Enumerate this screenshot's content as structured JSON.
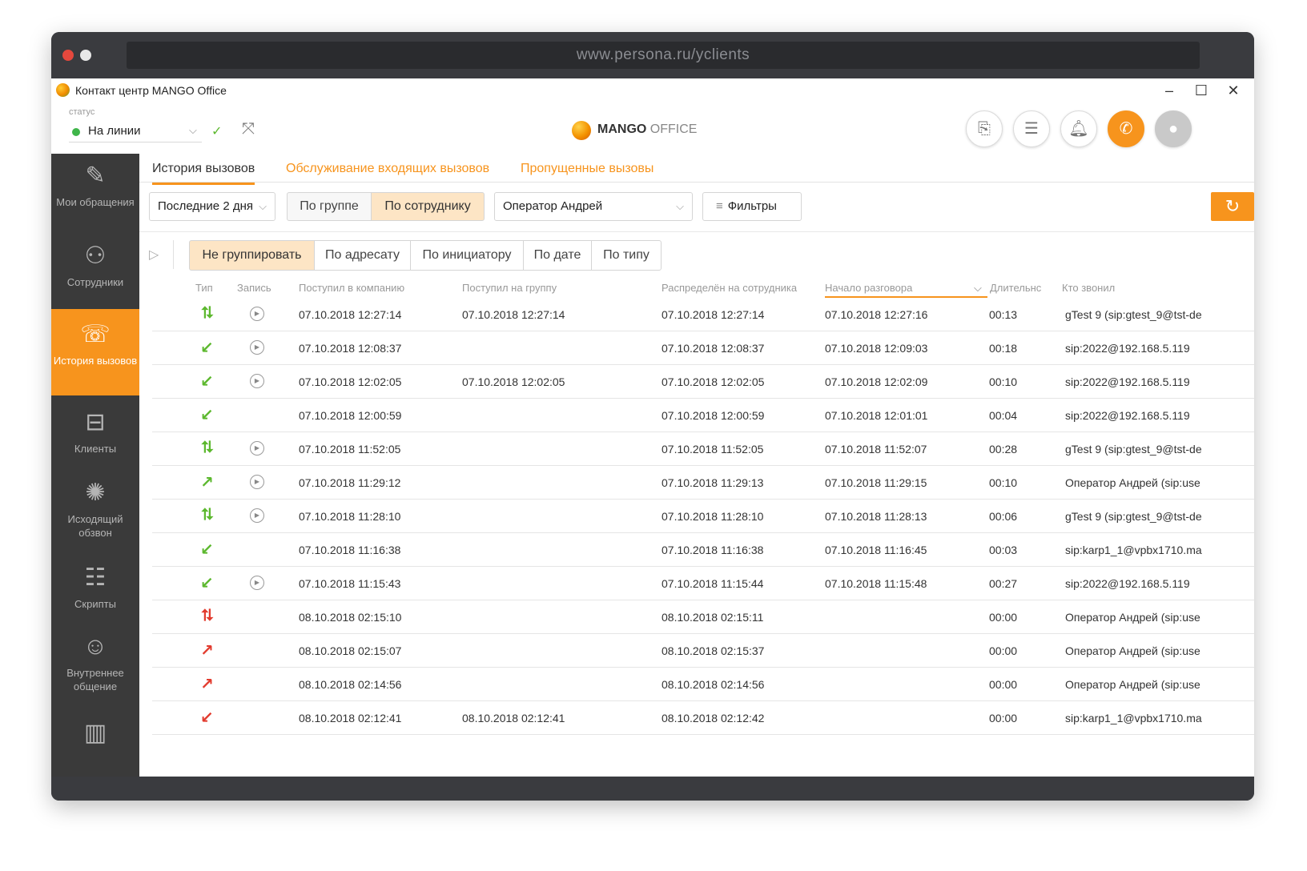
{
  "browser": {
    "url": "www.persona.ru/yclients"
  },
  "window": {
    "title": "Контакт центр MANGO Office",
    "minimize": "–",
    "maximize": "☐",
    "close": "✕"
  },
  "header": {
    "status_caption": "статус",
    "status_value": "На линии",
    "brand_main": "MANGO",
    "brand_sub": " OFFICE"
  },
  "sidebar": {
    "items": [
      {
        "label": "Мои обращения",
        "icon": "requests-icon"
      },
      {
        "label": "Сотрудники",
        "icon": "employees-icon"
      },
      {
        "label": "История вызовов",
        "icon": "call-history-icon"
      },
      {
        "label": "Клиенты",
        "icon": "clients-icon"
      },
      {
        "label": "Исходящий обзвон",
        "icon": "outbound-call-icon"
      },
      {
        "label": "Скрипты",
        "icon": "scripts-icon"
      },
      {
        "label": "Внутреннее общение",
        "icon": "internal-chat-icon"
      }
    ]
  },
  "tabs": [
    "История вызовов",
    "Обслуживание входящих вызовов",
    "Пропущенные вызовы"
  ],
  "filters": {
    "period": "Последние 2 дня",
    "by_group": "По группе",
    "by_employee": "По сотруднику",
    "operator": "Оператор Андрей",
    "filters_btn": "Фильтры"
  },
  "grouping": [
    "Не группировать",
    "По адресату",
    "По инициатору",
    "По дате",
    "По типу"
  ],
  "columns": [
    "Тип",
    "Запись",
    "Поступил в компанию",
    "Поступил на группу",
    "Распределён на сотрудника",
    "Начало разговора",
    "Длительнс",
    "Кто звонил"
  ],
  "colors": {
    "accent": "#f7941d",
    "green": "#5cb82e",
    "red": "#e23b2e",
    "sidebar": "#3a3a3a"
  },
  "rows": [
    {
      "type": "transfer",
      "color": "green",
      "rec": true,
      "company": "07.10.2018 12:27:14",
      "group": "07.10.2018 12:27:14",
      "employee": "07.10.2018 12:27:14",
      "start": "07.10.2018 12:27:16",
      "dur": "00:13",
      "caller": "gTest 9 (sip:gtest_9@tst-de"
    },
    {
      "type": "incoming",
      "color": "green",
      "rec": true,
      "company": "07.10.2018 12:08:37",
      "group": "",
      "employee": "07.10.2018 12:08:37",
      "start": "07.10.2018 12:09:03",
      "dur": "00:18",
      "caller": "sip:2022@192.168.5.119"
    },
    {
      "type": "incoming",
      "color": "green",
      "rec": true,
      "company": "07.10.2018 12:02:05",
      "group": "07.10.2018 12:02:05",
      "employee": "07.10.2018 12:02:05",
      "start": "07.10.2018 12:02:09",
      "dur": "00:10",
      "caller": "sip:2022@192.168.5.119"
    },
    {
      "type": "incoming",
      "color": "green",
      "rec": false,
      "company": "07.10.2018 12:00:59",
      "group": "",
      "employee": "07.10.2018 12:00:59",
      "start": "07.10.2018 12:01:01",
      "dur": "00:04",
      "caller": "sip:2022@192.168.5.119"
    },
    {
      "type": "transfer",
      "color": "green",
      "rec": true,
      "company": "07.10.2018 11:52:05",
      "group": "",
      "employee": "07.10.2018 11:52:05",
      "start": "07.10.2018 11:52:07",
      "dur": "00:28",
      "caller": "gTest 9 (sip:gtest_9@tst-de"
    },
    {
      "type": "outgoing",
      "color": "green",
      "rec": true,
      "company": "07.10.2018 11:29:12",
      "group": "",
      "employee": "07.10.2018 11:29:13",
      "start": "07.10.2018 11:29:15",
      "dur": "00:10",
      "caller": "Оператор Андрей (sip:use"
    },
    {
      "type": "transfer",
      "color": "green",
      "rec": true,
      "company": "07.10.2018 11:28:10",
      "group": "",
      "employee": "07.10.2018 11:28:10",
      "start": "07.10.2018 11:28:13",
      "dur": "00:06",
      "caller": "gTest 9 (sip:gtest_9@tst-de"
    },
    {
      "type": "incoming",
      "color": "green",
      "rec": false,
      "company": "07.10.2018 11:16:38",
      "group": "",
      "employee": "07.10.2018 11:16:38",
      "start": "07.10.2018 11:16:45",
      "dur": "00:03",
      "caller": "sip:karp1_1@vpbx1710.ma"
    },
    {
      "type": "incoming",
      "color": "green",
      "rec": true,
      "company": "07.10.2018 11:15:43",
      "group": "",
      "employee": "07.10.2018 11:15:44",
      "start": "07.10.2018 11:15:48",
      "dur": "00:27",
      "caller": "sip:2022@192.168.5.119"
    },
    {
      "type": "transfer",
      "color": "red",
      "rec": false,
      "company": "08.10.2018 02:15:10",
      "group": "",
      "employee": "08.10.2018 02:15:11",
      "start": "",
      "dur": "00:00",
      "caller": "Оператор Андрей (sip:use"
    },
    {
      "type": "outgoing",
      "color": "red",
      "rec": false,
      "company": "08.10.2018 02:15:07",
      "group": "",
      "employee": "08.10.2018 02:15:37",
      "start": "",
      "dur": "00:00",
      "caller": "Оператор Андрей (sip:use"
    },
    {
      "type": "outgoing",
      "color": "red",
      "rec": false,
      "company": "08.10.2018 02:14:56",
      "group": "",
      "employee": "08.10.2018 02:14:56",
      "start": "",
      "dur": "00:00",
      "caller": "Оператор Андрей (sip:use"
    },
    {
      "type": "incoming",
      "color": "red",
      "rec": false,
      "company": "08.10.2018 02:12:41",
      "group": "08.10.2018 02:12:41",
      "employee": "08.10.2018 02:12:42",
      "start": "",
      "dur": "00:00",
      "caller": "sip:karp1_1@vpbx1710.ma"
    }
  ]
}
